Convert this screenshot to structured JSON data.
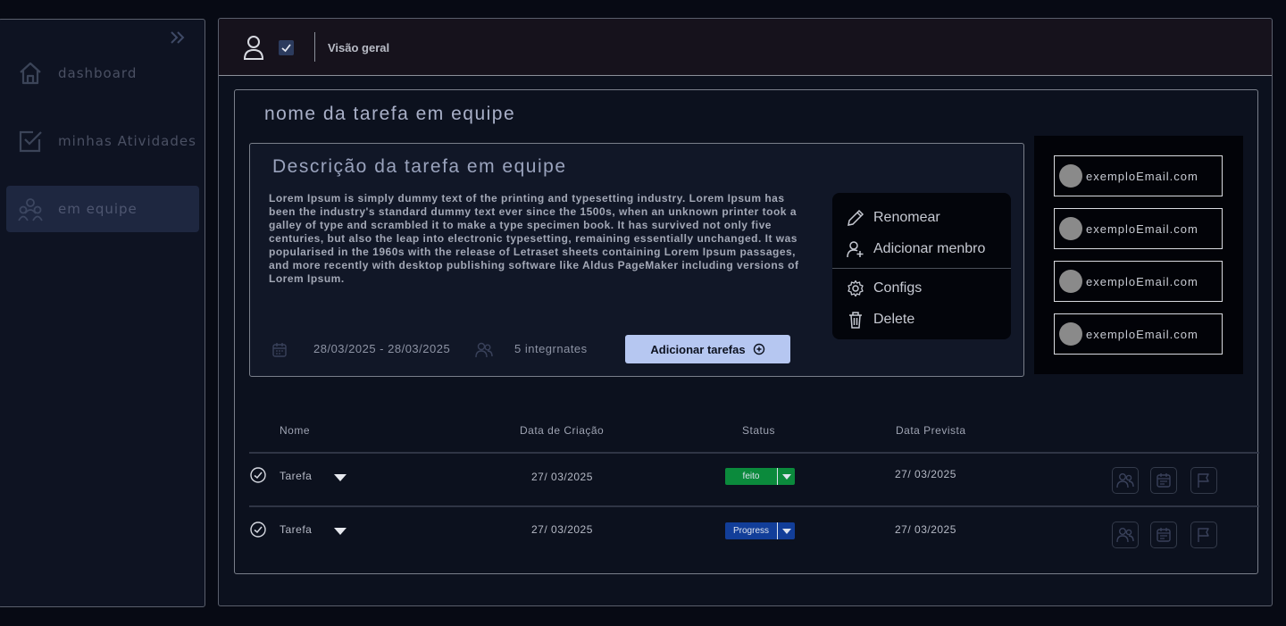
{
  "sidebar": {
    "items": [
      {
        "label": "dashboard",
        "icon": "home-icon"
      },
      {
        "label": "minhas Atividades",
        "icon": "checkbox-icon"
      },
      {
        "label": "em equipe",
        "icon": "team-icon"
      }
    ]
  },
  "topbar": {
    "breadcrumb": "Visão geral"
  },
  "task": {
    "title": "nome da tarefa em equipe",
    "description_title": "Descrição da tarefa em equipe",
    "description": "Lorem Ipsum is simply dummy text of the printing and typesetting industry. Lorem Ipsum has been the industry's standard dummy text ever since the 1500s, when an unknown printer took a galley of type and scrambled it to make a type specimen book. It has survived not only five centuries, but also the leap into electronic typesetting, remaining essentially unchanged. It was popularised in the 1960s with the release of Letraset sheets containing Lorem Ipsum passages, and more recently with desktop publishing software like Aldus PageMaker including versions of Lorem Ipsum.",
    "date_range": "28/03/2025 -  28/03/2025",
    "members_count": "5 integrnates",
    "add_button": "Adicionar tarefas"
  },
  "context_menu": {
    "rename": "Renomear",
    "add_member": "Adicionar menbro",
    "configs": "Configs",
    "delete": "Delete"
  },
  "members": [
    "exemploEmail.com",
    "exemploEmail.com",
    "exemploEmail.com",
    "exemploEmail.com"
  ],
  "table": {
    "headers": {
      "name": "Nome",
      "created": "Data de Criação",
      "status": "Status",
      "due": "Data Prevista"
    },
    "rows": [
      {
        "name": "Tarefa",
        "created": "27/ 03/2025",
        "status": "feito",
        "status_color": "#0b8a3c",
        "due": "27/ 03/2025"
      },
      {
        "name": "Tarefa",
        "created": "27/ 03/2025",
        "status": "Progress",
        "status_color": "#123e99",
        "due": "27/ 03/2025"
      }
    ]
  },
  "colors": {
    "accent_button": "#b6c7f1",
    "sidebar_active": "#1e2740"
  }
}
